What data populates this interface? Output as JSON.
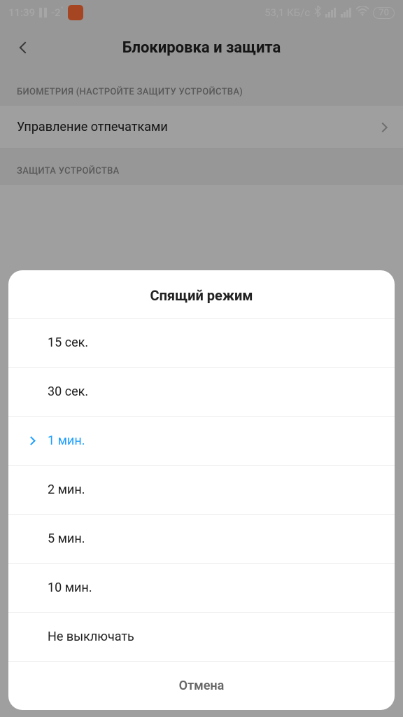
{
  "status": {
    "time": "11:39",
    "temp": "-2",
    "speed": "53,1 КБ/с",
    "battery": "70"
  },
  "header": {
    "title": "Блокировка и защита"
  },
  "sections": {
    "biometry": "БИОМЕТРИЯ (НАСТРОЙТЕ ЗАЩИТУ УСТРОЙСТВА)",
    "fingerprint": "Управление отпечатками",
    "protection": "ЗАЩИТА УСТРОЙСТВА"
  },
  "dialog": {
    "title": "Спящий режим",
    "options": [
      "15 сек.",
      "30 сек.",
      "1 мин.",
      "2 мин.",
      "5 мин.",
      "10 мин.",
      "Не выключать"
    ],
    "selected_index": 2,
    "cancel": "Отмена"
  }
}
